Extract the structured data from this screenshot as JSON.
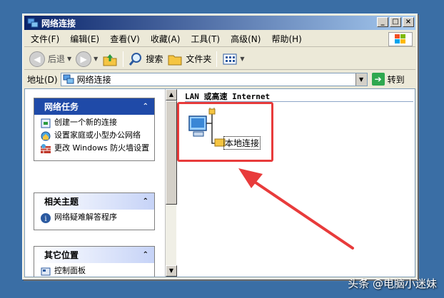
{
  "window": {
    "title": "网络连接"
  },
  "menu": [
    "文件(F)",
    "编辑(E)",
    "查看(V)",
    "收藏(A)",
    "工具(T)",
    "高级(N)",
    "帮助(H)"
  ],
  "toolbar": {
    "back_label": "后退",
    "search_label": "搜索",
    "folders_label": "文件夹"
  },
  "address": {
    "label": "地址(D)",
    "value": "网络连接",
    "go_label": "转到"
  },
  "tasks_panel": {
    "title": "网络任务",
    "items": [
      "创建一个新的连接",
      "设置家庭或小型办公网络",
      "更改 Windows 防火墙设置"
    ]
  },
  "related_panel": {
    "title": "相关主题",
    "items": [
      "网络疑难解答程序"
    ]
  },
  "other_panel": {
    "title": "其它位置",
    "items": [
      "控制面板"
    ]
  },
  "content": {
    "group_header": "LAN 或高速 Internet",
    "connection_label": "本地连接"
  },
  "watermark": "头条 @电脑小迷妹",
  "colors": {
    "title_start": "#0a246a",
    "title_end": "#a6caf0",
    "highlight": "#e83b3b",
    "desktop": "#3a6ea5"
  }
}
